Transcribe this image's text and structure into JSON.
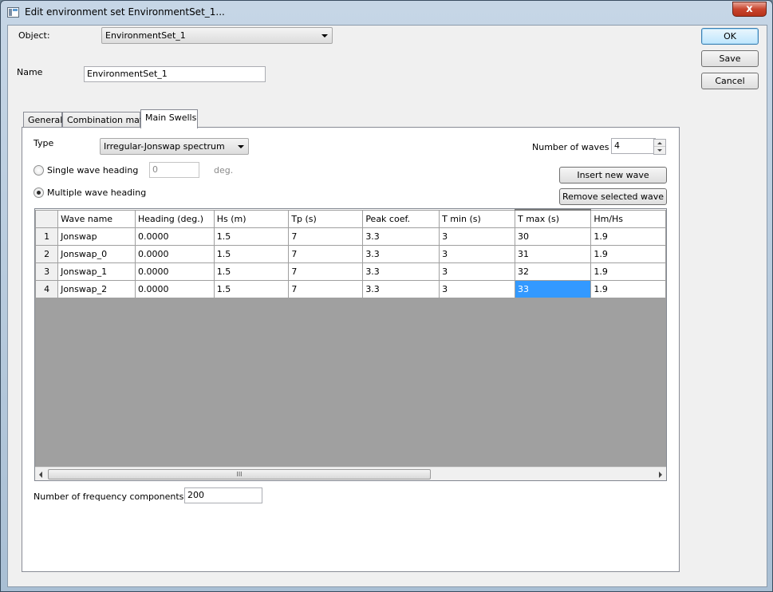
{
  "window": {
    "title": "Edit environment set EnvironmentSet_1...",
    "close_symbol": "x"
  },
  "object": {
    "label": "Object:",
    "value": "EnvironmentSet_1"
  },
  "name": {
    "label": "Name",
    "value": "EnvironmentSet_1"
  },
  "buttons": {
    "ok": "OK",
    "save": "Save",
    "cancel": "Cancel"
  },
  "tabs": [
    {
      "label": "General"
    },
    {
      "label": "Combination matrix"
    },
    {
      "label": "Main Swells",
      "active": true
    }
  ],
  "main_swells": {
    "type_label": "Type",
    "type_value": "Irregular-Jonswap spectrum",
    "num_waves_label": "Number of waves",
    "num_waves_value": "4",
    "single_heading_label": "Single wave heading",
    "single_heading_value": "0",
    "single_heading_unit": "deg.",
    "multiple_heading_label": "Multiple wave heading",
    "multiple_heading_checked": true,
    "insert_button": "Insert new wave",
    "remove_button": "Remove selected wave",
    "freq_label": "Number of frequency components",
    "freq_value": "200",
    "scroll_grip": "III"
  },
  "table": {
    "columns": [
      "Wave name",
      "Heading (deg.)",
      "Hs (m)",
      "Tp (s)",
      "Peak coef.",
      "T min (s)",
      "T max (s)",
      "Hm/Hs"
    ],
    "rows": [
      {
        "n": "1",
        "cells": [
          "Jonswap",
          "0.0000",
          "1.5",
          "7",
          "3.3",
          "3",
          "30",
          "1.9"
        ]
      },
      {
        "n": "2",
        "cells": [
          "Jonswap_0",
          "0.0000",
          "1.5",
          "7",
          "3.3",
          "3",
          "31",
          "1.9"
        ]
      },
      {
        "n": "3",
        "cells": [
          "Jonswap_1",
          "0.0000",
          "1.5",
          "7",
          "3.3",
          "3",
          "32",
          "1.9"
        ]
      },
      {
        "n": "4",
        "cells": [
          "Jonswap_2",
          "0.0000",
          "1.5",
          "7",
          "3.3",
          "3",
          "33",
          "1.9"
        ]
      }
    ],
    "selected_cell": {
      "row": 3,
      "col": 6
    }
  },
  "colors": {
    "selection": "#3399ff",
    "grid_empty": "#a0a0a0",
    "titlebar": "#b9cde0"
  }
}
